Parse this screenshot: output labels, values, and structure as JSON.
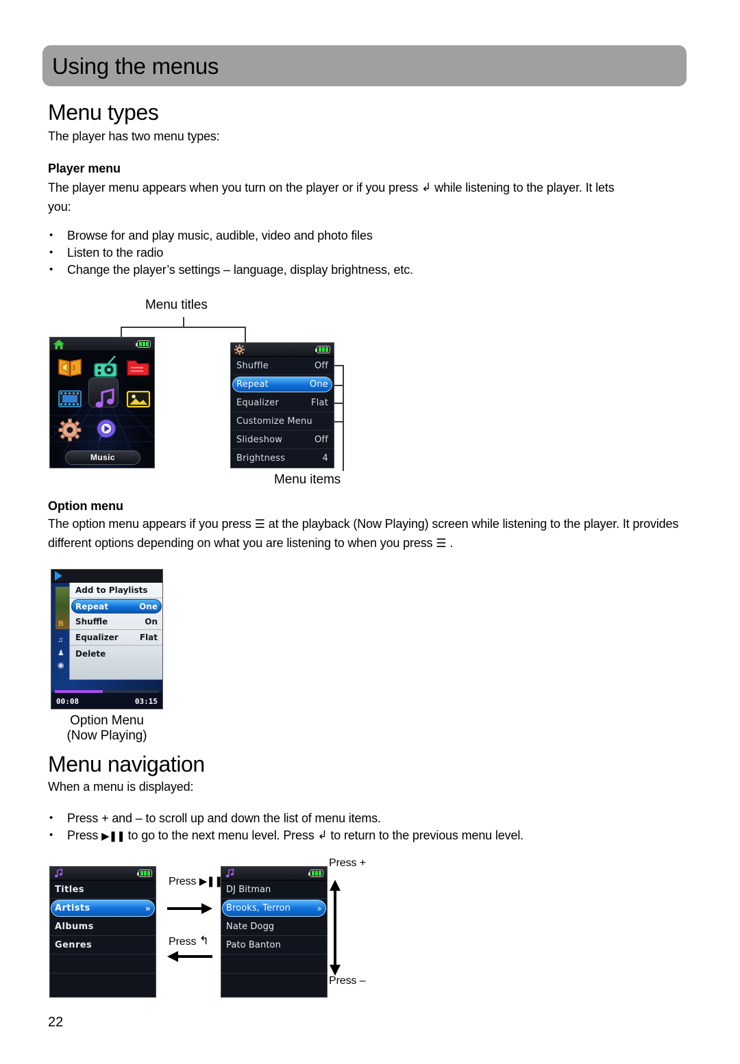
{
  "page": {
    "header_title": "Using the menus",
    "page_number": "22"
  },
  "section_menu_types": {
    "heading": "Menu types",
    "intro": "The player has two menu types:",
    "player_menu": {
      "heading": "Player menu",
      "paragraph_line1": "The player menu appears when you turn on the player or if you press",
      "paragraph_icon": "back-icon",
      "paragraph_line1_cont": "while listening to the player. It lets",
      "paragraph_line2": "you:",
      "bullets": [
        "Browse for and play music, audible, video and photo files",
        "Listen to the radio",
        "Change the player’s settings – language, display brightness, etc."
      ]
    },
    "option_menu": {
      "heading": "Option menu",
      "line1_a": "The option menu appears if you press",
      "line1_b": "at the playback (Now Playing) screen while listening to the player. It",
      "line2_a": "provides different options depending on what you are listening to when you press",
      "line2_b": "."
    }
  },
  "callouts": {
    "menu_titles": "Menu titles",
    "menu_items": "Menu items",
    "option_menu_caption_line1": "Option Menu",
    "option_menu_caption_line2": "(Now Playing)"
  },
  "home_screen": {
    "title_icon": "home-icon",
    "battery_icon": "battery-full-icon",
    "tiles": [
      {
        "name": "audible-book-icon",
        "label": "Audible"
      },
      {
        "name": "radio-icon",
        "label": "Radio"
      },
      {
        "name": "folder-icon",
        "label": "Folder"
      },
      {
        "name": "video-icon",
        "label": "Video"
      },
      {
        "name": "music-note-icon",
        "label": "Music"
      },
      {
        "name": "photo-icon",
        "label": "Photo"
      },
      {
        "name": "settings-gear-icon",
        "label": "Settings"
      },
      {
        "name": "now-playing-icon",
        "label": "Now Playing"
      }
    ],
    "selected_label": "Music"
  },
  "settings_screen": {
    "title_icon": "settings-gear-icon",
    "battery_icon": "battery-full-icon",
    "rows": [
      {
        "label": "Shuffle",
        "value": "Off",
        "selected": false
      },
      {
        "label": "Repeat",
        "value": "One",
        "selected": true
      },
      {
        "label": "Equalizer",
        "value": "Flat",
        "selected": false
      },
      {
        "label": "Customize Menu",
        "value": "",
        "selected": false
      },
      {
        "label": "Slideshow",
        "value": "Off",
        "selected": false
      },
      {
        "label": "Brightness",
        "value": "4",
        "selected": false
      }
    ]
  },
  "nowplaying_screen": {
    "play_icon": "play-icon",
    "album_art_text": "B",
    "side_icons": [
      "music-note-icon",
      "artist-icon",
      "album-icon"
    ],
    "popup_items": [
      {
        "label": "Add to Playlists",
        "value": "",
        "selected": false
      },
      {
        "label": "Repeat",
        "value": "One",
        "selected": true
      },
      {
        "label": "Shuffle",
        "value": "On",
        "selected": false
      },
      {
        "label": "Equalizer",
        "value": "Flat",
        "selected": false
      },
      {
        "label": "Delete",
        "value": "",
        "selected": false
      }
    ],
    "elapsed_time": "00:08",
    "total_time": "03:15"
  },
  "section_menu_navigation": {
    "heading": "Menu navigation",
    "intro": "When a menu is displayed:",
    "bullets": [
      "Press + and – to scroll up and down the list of menu items.",
      {
        "a": "Press",
        "icon": "play-pause-icon",
        "b": "to go to the next menu level. Press",
        "icon2": "back-icon",
        "c": "to return to the previous menu level."
      }
    ]
  },
  "browse_screen_1": {
    "title_icon": "music-note-icon",
    "battery_icon": "battery-full-icon",
    "rows": [
      {
        "label": "Titles",
        "value": "",
        "selected": false
      },
      {
        "label": "Artists",
        "value": "»",
        "selected": true
      },
      {
        "label": "Albums",
        "value": "",
        "selected": false
      },
      {
        "label": "Genres",
        "value": "",
        "selected": false
      }
    ]
  },
  "browse_screen_2": {
    "title_icon": "music-note-icon",
    "battery_icon": "battery-full-icon",
    "rows": [
      {
        "label": "DJ Bitman",
        "value": "",
        "selected": false
      },
      {
        "label": "Brooks, Terron",
        "value": "»",
        "selected": true
      },
      {
        "label": "Nate Dogg",
        "value": "",
        "selected": false
      },
      {
        "label": "Pato Banton",
        "value": "",
        "selected": false
      }
    ]
  },
  "nav_diagram": {
    "press_play_label": "Press",
    "press_play_icon": "play-pause-icon",
    "press_back_label": "Press",
    "press_back_icon": "back-icon",
    "press_plus": "Press +",
    "press_minus": "Press –"
  }
}
